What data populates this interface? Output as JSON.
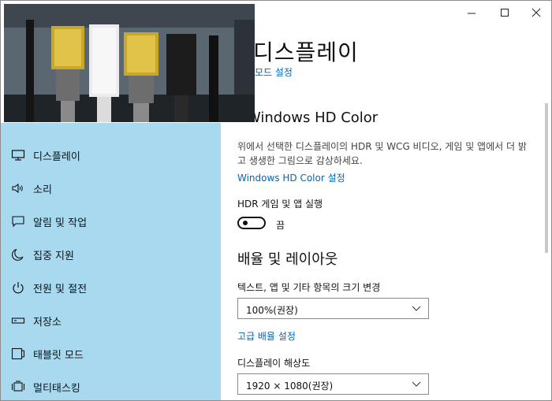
{
  "window": {
    "controls": [
      "minimize",
      "maximize",
      "close"
    ]
  },
  "sidebar": {
    "items": [
      {
        "label": "디스플레이",
        "icon": "monitor-icon",
        "selected": true
      },
      {
        "label": "소리",
        "icon": "speaker-icon",
        "selected": false
      },
      {
        "label": "알림 및 작업",
        "icon": "notification-icon",
        "selected": false
      },
      {
        "label": "집중 지원",
        "icon": "moon-icon",
        "selected": false
      },
      {
        "label": "전원 및 절전",
        "icon": "power-icon",
        "selected": false
      },
      {
        "label": "저장소",
        "icon": "storage-icon",
        "selected": false
      },
      {
        "label": "태블릿 모드",
        "icon": "tablet-icon",
        "selected": false
      },
      {
        "label": "멀티태스킹",
        "icon": "multitask-icon",
        "selected": false
      }
    ],
    "background": "#a8d9ef"
  },
  "main": {
    "title": "디스플레이",
    "top_link": "모드 설정",
    "hd_color": {
      "heading": "Windows HD Color",
      "description": "위에서 선택한 디스플레이의 HDR 및 WCG 비디오, 게임 및 앱에서 더 밝고 생생한 그림으로 감상하세요.",
      "settings_link": "Windows HD Color 설정",
      "hdr_label": "HDR 게임 및 앱 실행",
      "toggle_state": "끔"
    },
    "scale_layout": {
      "heading": "배율 및 레이아웃",
      "scale_label": "텍스트, 앱 및 기타 항목의 크기 변경",
      "scale_value": "100%(권장)",
      "advanced_link": "고급 배율 설정",
      "resolution_label": "디스플레이 해상도",
      "resolution_value": "1920 × 1080(권장)"
    }
  },
  "colors": {
    "accent_link": "#0067b8",
    "sidebar_bg": "#a8d9ef"
  }
}
